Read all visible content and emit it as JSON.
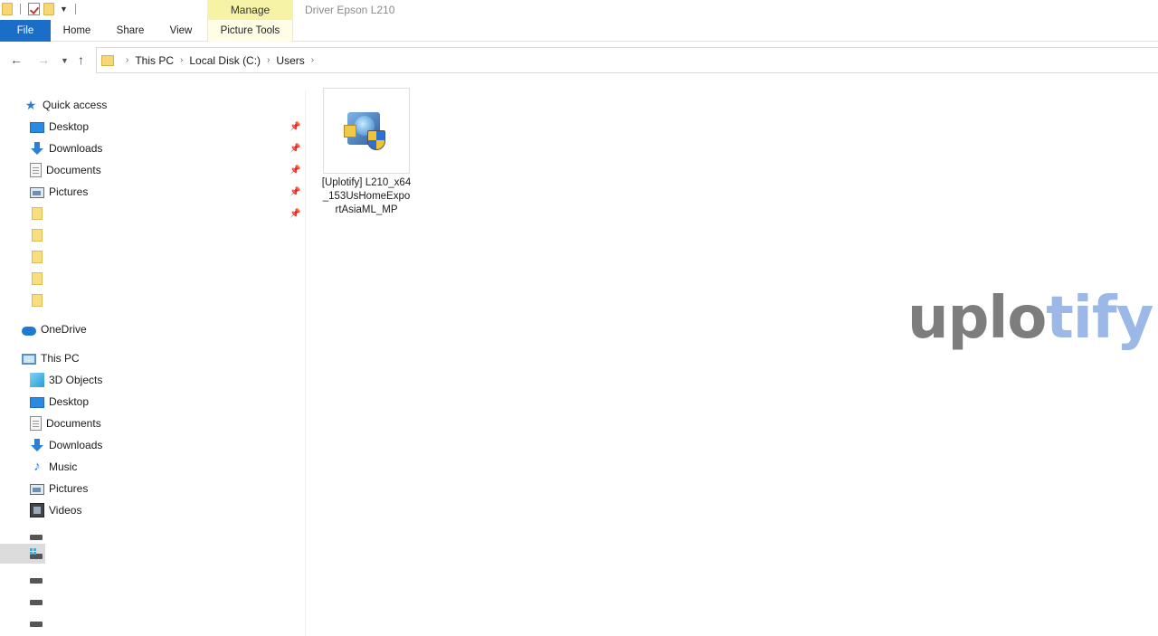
{
  "window": {
    "title": "Driver Epson L210",
    "manage_label": "Manage"
  },
  "ribbon": {
    "tabs": [
      "File",
      "Home",
      "Share",
      "View",
      "Picture Tools"
    ]
  },
  "breadcrumb": [
    "This PC",
    "Local Disk (C:)",
    "Users"
  ],
  "sidebar": {
    "quick_access": {
      "label": "Quick access",
      "items": [
        {
          "label": "Desktop",
          "icon": "desktop-icon",
          "pinned": true
        },
        {
          "label": "Downloads",
          "icon": "downloads-icon",
          "pinned": true
        },
        {
          "label": "Documents",
          "icon": "documents-icon",
          "pinned": true
        },
        {
          "label": "Pictures",
          "icon": "pictures-icon",
          "pinned": true
        },
        {
          "label": "",
          "icon": "folder-icon",
          "pinned": true
        },
        {
          "label": "",
          "icon": "folder-icon",
          "pinned": false
        },
        {
          "label": "",
          "icon": "folder-icon",
          "pinned": false
        },
        {
          "label": "",
          "icon": "folder-icon",
          "pinned": false
        },
        {
          "label": "",
          "icon": "folder-icon",
          "pinned": false
        }
      ]
    },
    "onedrive": {
      "label": "OneDrive"
    },
    "this_pc": {
      "label": "This PC",
      "items": [
        {
          "label": "3D Objects",
          "icon": "3d-objects-icon"
        },
        {
          "label": "Desktop",
          "icon": "desktop-icon"
        },
        {
          "label": "Documents",
          "icon": "documents-icon"
        },
        {
          "label": "Downloads",
          "icon": "downloads-icon"
        },
        {
          "label": "Music",
          "icon": "music-icon"
        },
        {
          "label": "Pictures",
          "icon": "pictures-icon"
        },
        {
          "label": "Videos",
          "icon": "videos-icon"
        }
      ]
    },
    "drives": [
      {
        "icon": "drive-icon",
        "selected": false
      },
      {
        "icon": "system-drive-icon",
        "selected": true
      },
      {
        "icon": "drive-icon",
        "selected": false
      },
      {
        "icon": "drive-icon",
        "selected": false
      },
      {
        "icon": "drive-icon",
        "selected": false
      }
    ]
  },
  "content": {
    "files": [
      {
        "name": "[Uplotify] L210_x64_153UsHomeExportAsiaML_MP",
        "icon": "installer-icon"
      }
    ]
  },
  "watermark": {
    "part1": "uplo",
    "part2": "tify"
  },
  "colors": {
    "file_tab": "#1a6ec7",
    "manage_highlight": "#f6f3a6",
    "folder": "#f9de80",
    "accent_blue": "#2b8ae0"
  }
}
